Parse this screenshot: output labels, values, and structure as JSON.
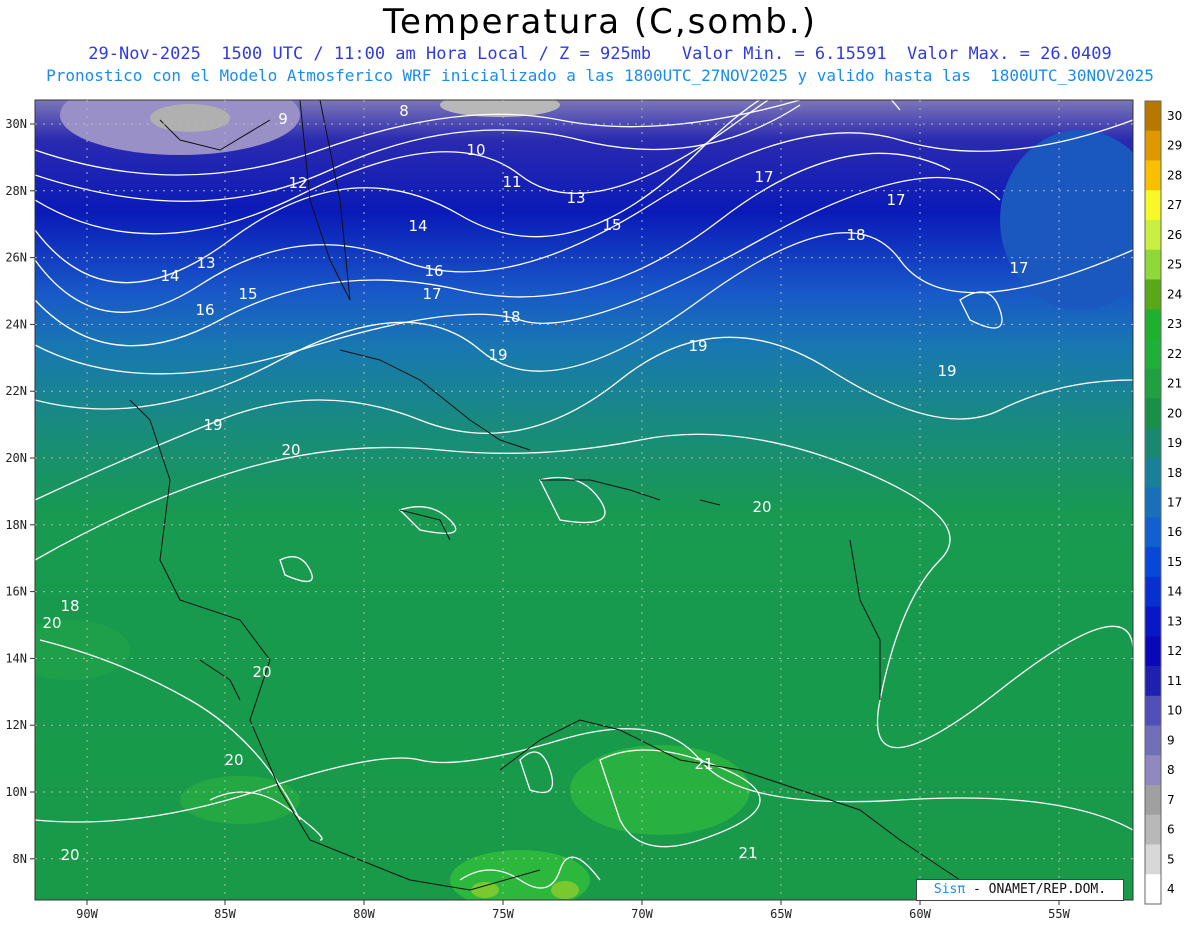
{
  "title": "Temperatura (C,somb.)",
  "subtitle_line1": "29-Nov-2025  1500 UTC / 11:00 am Hora Local / Z = 925mb   Valor Min. = 6.15591  Valor Max. = 26.0409",
  "subtitle_line2": "Pronostico con el Modelo Atmosferico WRF inicializado a las 1800UTC_27NOV2025 y valido hasta las  1800UTC_30NOV2025",
  "credit": {
    "logo": "Sisπ",
    "text": " - ONAMET/REP.DOM."
  },
  "lon_ticks": [
    "90W",
    "85W",
    "80W",
    "75W",
    "70W",
    "65W",
    "60W",
    "55W"
  ],
  "lat_ticks": [
    "30N",
    "28N",
    "26N",
    "24N",
    "22N",
    "20N",
    "18N",
    "16N",
    "14N",
    "12N",
    "10N",
    "8N"
  ],
  "colorbar": {
    "levels": [
      "30",
      "29",
      "28",
      "27",
      "26",
      "25",
      "24",
      "23",
      "22",
      "21",
      "20",
      "19",
      "18",
      "17",
      "16",
      "15",
      "14",
      "13",
      "12",
      "11",
      "10",
      "9",
      "8",
      "7",
      "6",
      "5",
      "4"
    ],
    "colors": [
      "#b87800",
      "#e09800",
      "#f8c000",
      "#f8f828",
      "#c8f040",
      "#90d838",
      "#58a818",
      "#20b030",
      "#20b038",
      "#20a040",
      "#189048",
      "#188870",
      "#188098",
      "#1870b8",
      "#1060d0",
      "#0848d8",
      "#0830d0",
      "#0818c8",
      "#0808b8",
      "#2020b0",
      "#5050b8",
      "#7070b8",
      "#9088c0",
      "#a0a0a0",
      "#b8b8b8",
      "#d8d8d8",
      "#ffffff"
    ]
  },
  "contour_labels": [
    {
      "text": "8"
    },
    {
      "text": "9"
    },
    {
      "text": "10"
    },
    {
      "text": "11"
    },
    {
      "text": "12"
    },
    {
      "text": "13"
    },
    {
      "text": "13"
    },
    {
      "text": "14"
    },
    {
      "text": "14"
    },
    {
      "text": "15"
    },
    {
      "text": "15"
    },
    {
      "text": "16"
    },
    {
      "text": "16"
    },
    {
      "text": "17"
    },
    {
      "text": "17"
    },
    {
      "text": "17"
    },
    {
      "text": "17"
    },
    {
      "text": "18"
    },
    {
      "text": "18"
    },
    {
      "text": "18"
    },
    {
      "text": "19"
    },
    {
      "text": "19"
    },
    {
      "text": "19"
    },
    {
      "text": "19"
    },
    {
      "text": "20"
    },
    {
      "text": "20"
    },
    {
      "text": "20"
    },
    {
      "text": "20"
    },
    {
      "text": "20"
    },
    {
      "text": "20"
    },
    {
      "text": "21"
    },
    {
      "text": "21"
    }
  ]
}
